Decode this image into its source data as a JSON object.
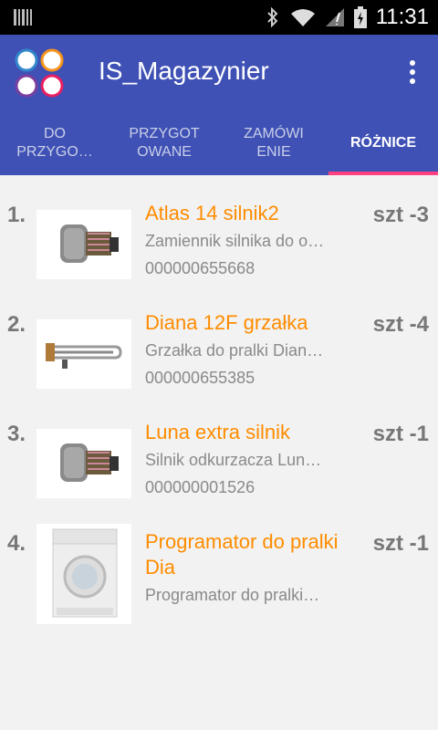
{
  "status": {
    "time": "11:31"
  },
  "app": {
    "title": "IS_Magazynier"
  },
  "tabs": [
    {
      "label": "DO\nPRZYGO…"
    },
    {
      "label": "PRZYGOT\nOWANE"
    },
    {
      "label": "ZAMÓWI\nENIE"
    },
    {
      "label": "RÓŻNICE"
    }
  ],
  "items": [
    {
      "index": "1.",
      "title": "Atlas 14 silnik2",
      "desc": "Zamiennik silnika do o…",
      "code": "000000655668",
      "qty": "szt -3",
      "image": "motor-icon"
    },
    {
      "index": "2.",
      "title": "Diana 12F grzałka",
      "desc": "Grzałka do pralki Dian…",
      "code": "000000655385",
      "qty": "szt -4",
      "image": "heater-icon"
    },
    {
      "index": "3.",
      "title": "Luna extra silnik",
      "desc": "Silnik odkurzacza Lun…",
      "code": "000000001526",
      "qty": "szt -1",
      "image": "motor-icon"
    },
    {
      "index": "4.",
      "title": "Programator do pralki Dia",
      "desc": "Programator do pralki…",
      "code": "",
      "qty": "szt -1",
      "image": "washing-machine-icon"
    }
  ],
  "colors": {
    "appbar": "#3f51b5",
    "accent": "#ff4081",
    "title": "#ff8c00"
  }
}
